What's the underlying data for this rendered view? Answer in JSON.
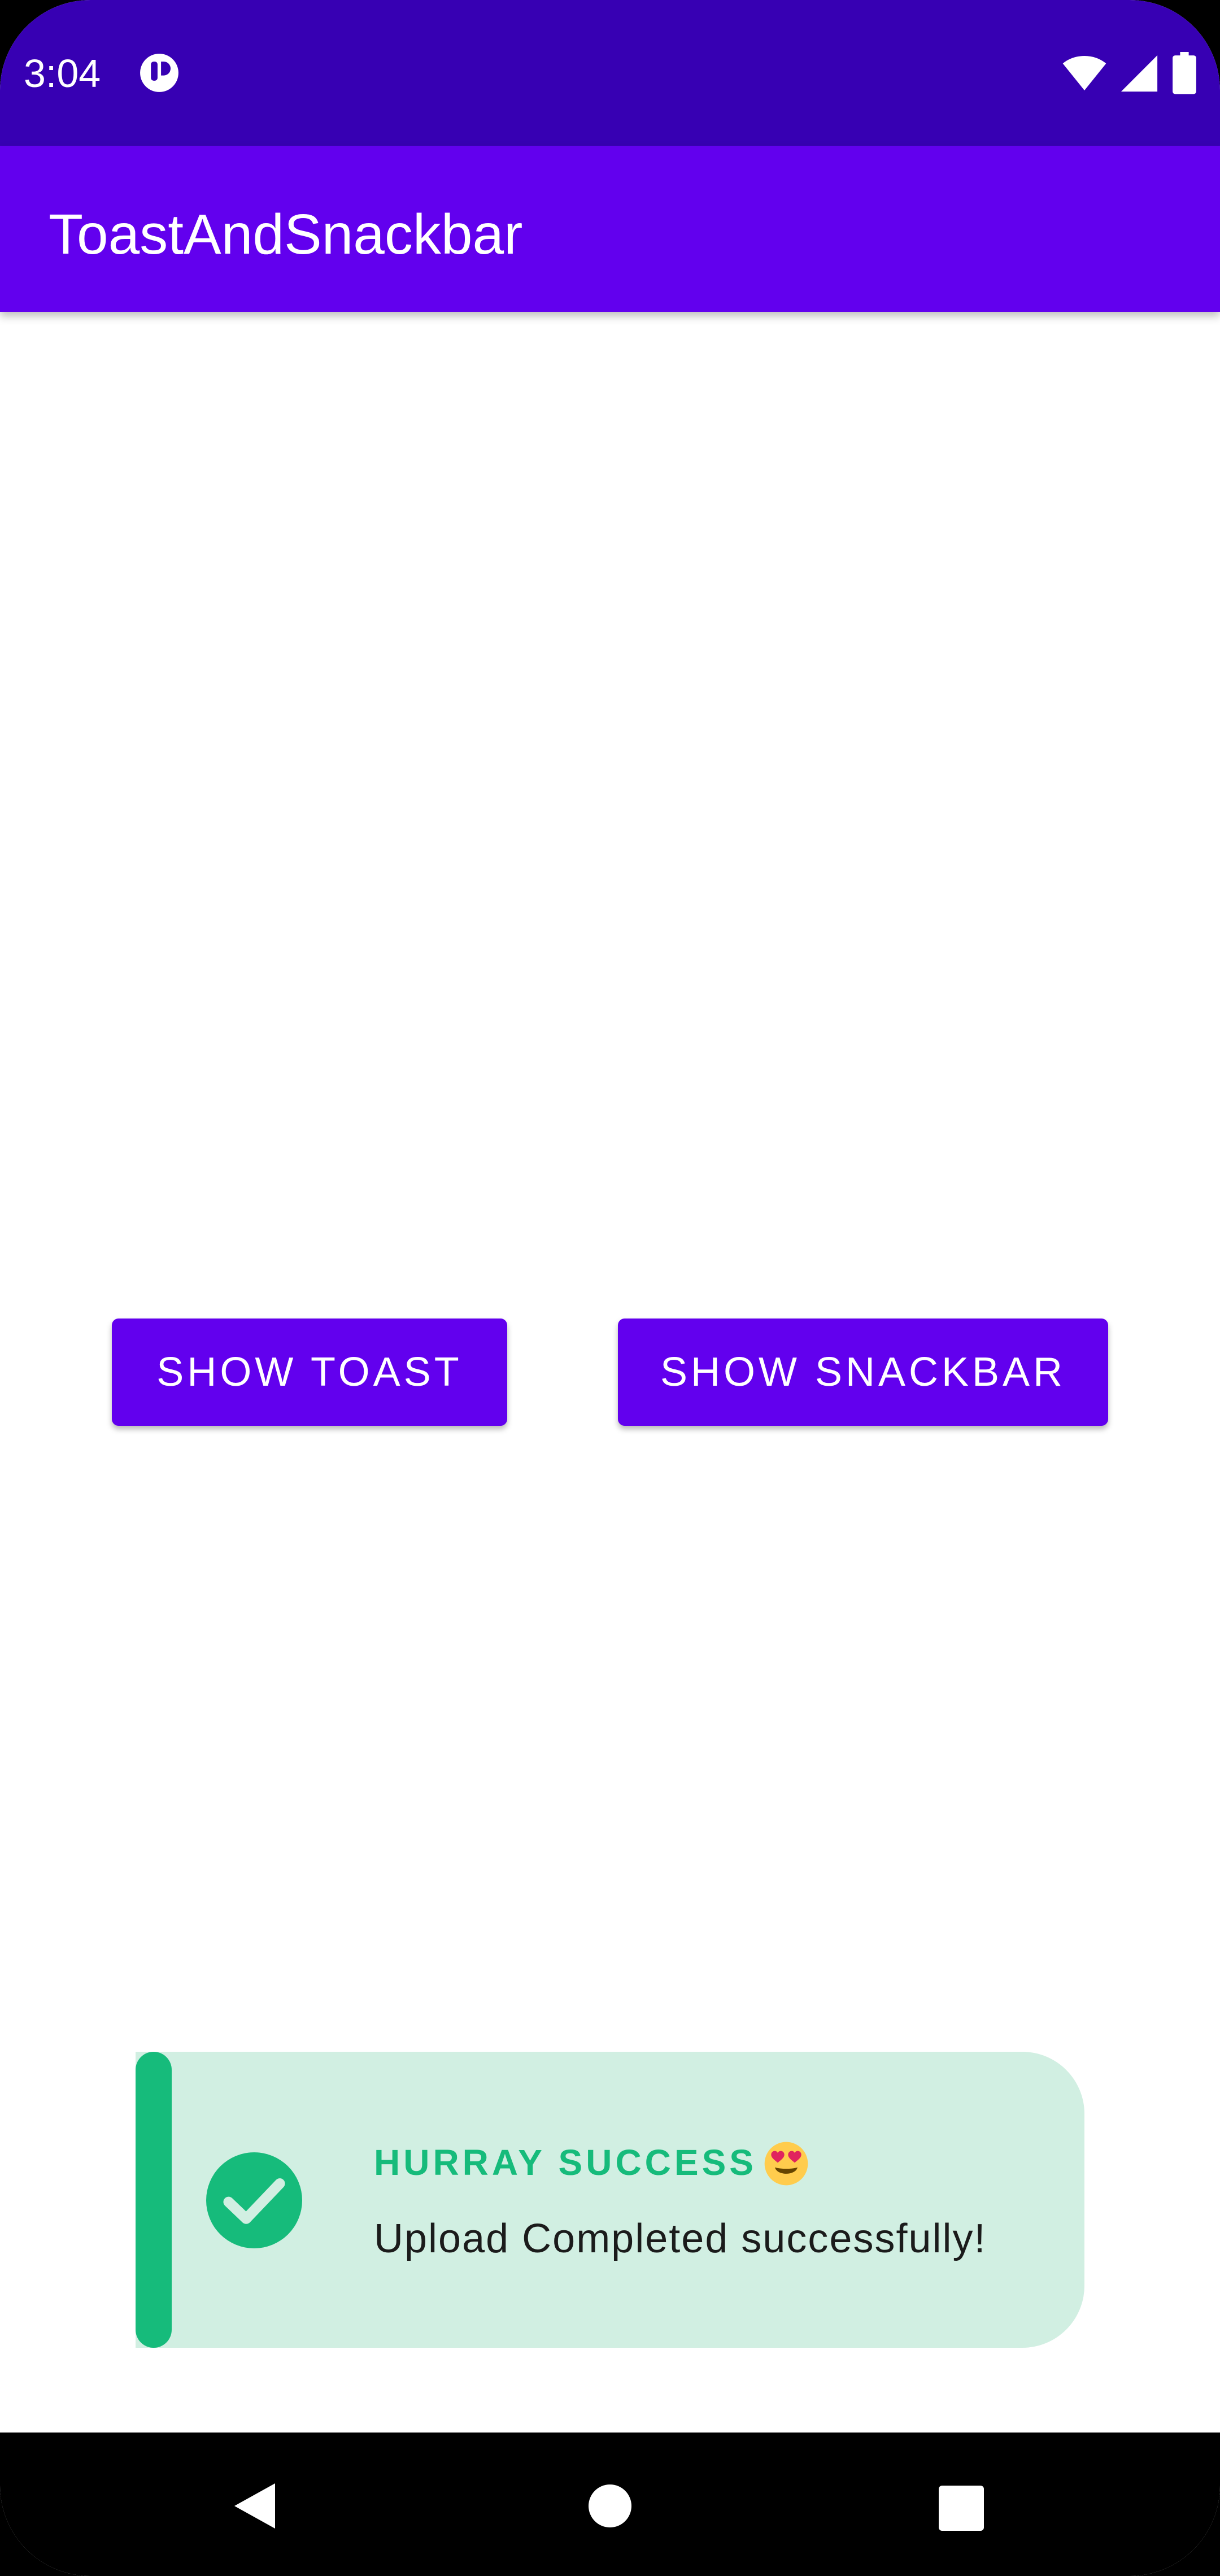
{
  "status_bar": {
    "time": "3:04",
    "icons": [
      "app-notification-icon",
      "wifi-icon",
      "cellular-signal-icon",
      "battery-icon"
    ],
    "background": "#3700b3"
  },
  "app_bar": {
    "title": "ToastAndSnackbar",
    "background": "#6200ee"
  },
  "buttons": {
    "show_toast": "SHOW TOAST",
    "show_snackbar": "SHOW SNACKBAR",
    "color": "#6200ee"
  },
  "toast": {
    "title": "HURRAY SUCCESS",
    "emoji_icon": "heart-eyes-emoji-icon",
    "message": "Upload Completed successfully!",
    "accent_color": "#16bb7b",
    "background": "#d1efe2",
    "icon": "check-circle-icon"
  },
  "nav_bar": {
    "icons": [
      "back-icon",
      "home-icon",
      "recents-icon"
    ]
  }
}
